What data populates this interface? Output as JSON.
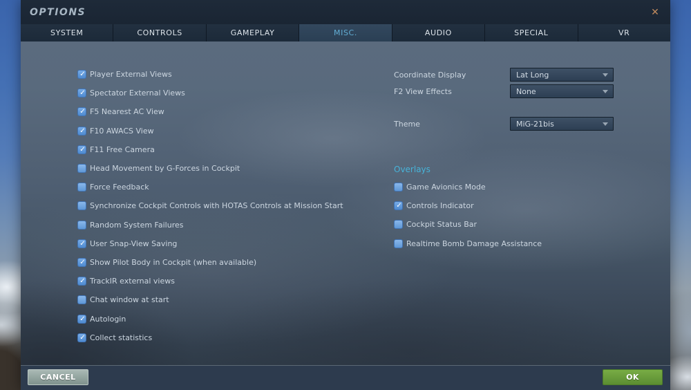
{
  "window": {
    "title": "OPTIONS"
  },
  "icons": {
    "close": "✕",
    "check": "✓"
  },
  "tabs": [
    {
      "label": "SYSTEM",
      "selected": false
    },
    {
      "label": "CONTROLS",
      "selected": false
    },
    {
      "label": "GAMEPLAY",
      "selected": false
    },
    {
      "label": "MISC.",
      "selected": true
    },
    {
      "label": "AUDIO",
      "selected": false
    },
    {
      "label": "SPECIAL",
      "selected": false
    },
    {
      "label": "VR",
      "selected": false
    }
  ],
  "left_options": [
    {
      "label": "Player External Views",
      "checked": true
    },
    {
      "label": "Spectator External Views",
      "checked": true
    },
    {
      "label": "F5 Nearest AC View",
      "checked": true
    },
    {
      "label": "F10 AWACS View",
      "checked": true
    },
    {
      "label": "F11 Free Camera",
      "checked": true
    },
    {
      "label": "Head Movement by G-Forces in Cockpit",
      "checked": false
    },
    {
      "label": "Force Feedback",
      "checked": false
    },
    {
      "label": "Synchronize Cockpit Controls with HOTAS Controls at Mission Start",
      "checked": false
    },
    {
      "label": "Random System Failures",
      "checked": false
    },
    {
      "label": "User Snap-View Saving",
      "checked": true
    },
    {
      "label": "Show Pilot Body in Cockpit (when available)",
      "checked": true
    },
    {
      "label": "TrackIR external views",
      "checked": true
    },
    {
      "label": "Chat window at start",
      "checked": false
    },
    {
      "label": "Autologin",
      "checked": true
    },
    {
      "label": "Collect statistics",
      "checked": true
    }
  ],
  "right_panel": {
    "settings": [
      {
        "label": "Coordinate Display",
        "value": "Lat Long"
      },
      {
        "label": "F2 View Effects",
        "value": "None"
      },
      {
        "label": "Theme",
        "value": "MiG-21bis"
      }
    ],
    "overlays": {
      "heading": "Overlays",
      "items": [
        {
          "label": "Game Avionics Mode",
          "checked": false
        },
        {
          "label": "Controls Indicator",
          "checked": true
        },
        {
          "label": "Cockpit Status Bar",
          "checked": false
        },
        {
          "label": "Realtime Bomb Damage Assistance",
          "checked": false
        }
      ]
    }
  },
  "footer": {
    "cancel_label": "CANCEL",
    "ok_label": "OK"
  },
  "colors": {
    "accent_tab_blue": "#62aed4",
    "overlays_heading": "#47b3d9",
    "checkbox_blue": "#5f98d7",
    "ok_green": "#6ba23f",
    "cancel_sage": "#94a5a0",
    "close_x": "#c18b5e"
  }
}
